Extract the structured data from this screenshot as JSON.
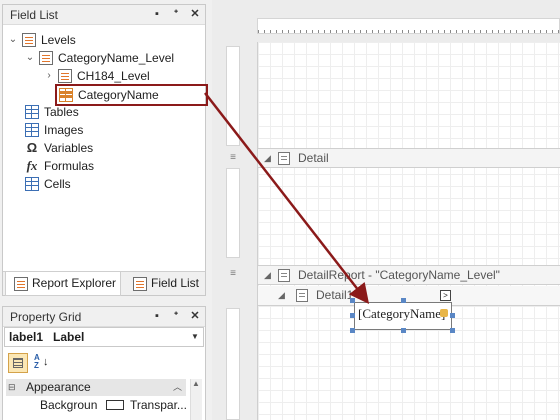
{
  "field_list": {
    "title": "Field List",
    "buttons": [
      "▪",
      "ᐩ",
      "✕"
    ],
    "tree": [
      {
        "label": "Levels",
        "expander": "⌄"
      },
      {
        "label": "CategoryName_Level",
        "expander": "⌄"
      },
      {
        "label": "CH184_Level",
        "expander": "›"
      },
      {
        "label": "CategoryName",
        "expander": ""
      },
      {
        "label": "Tables",
        "expander": ""
      },
      {
        "label": "Images",
        "expander": ""
      },
      {
        "label": "Variables",
        "expander": ""
      },
      {
        "label": "Formulas",
        "expander": ""
      },
      {
        "label": "Cells",
        "expander": ""
      }
    ],
    "icon_glyphs": {
      "variables": "Ω",
      "formulas": "fx"
    }
  },
  "tabs": {
    "report_explorer": "Report Explorer",
    "field_list": "Field List"
  },
  "property_grid": {
    "title": "Property Grid",
    "buttons": [
      "▪",
      "ᐩ",
      "✕"
    ],
    "selected_object": "label1   Label",
    "sort_icon_text": "AZ",
    "category": "Appearance",
    "rows": [
      {
        "name": "Backgroun",
        "value": "Transpar..."
      }
    ]
  },
  "designer": {
    "bands": {
      "detail": "Detail",
      "detail_report": "DetailReport - \"CategoryName_Level\"",
      "detail1": "Detail1"
    },
    "label_text": "[CategoryName]",
    "smart_tag": ">"
  },
  "colors": {
    "highlight_border": "#8b1a1a",
    "arrow": "#8b1a1a",
    "selection_handle": "#5a87c5"
  }
}
